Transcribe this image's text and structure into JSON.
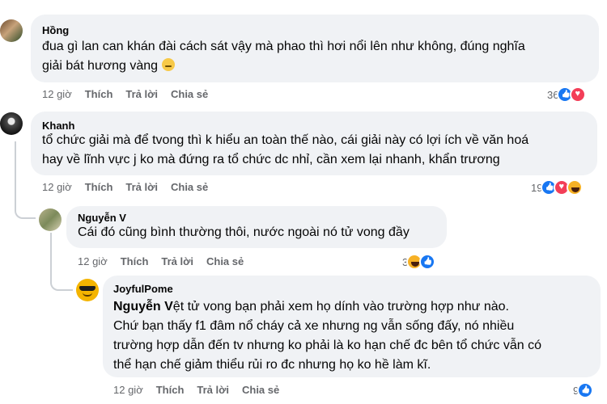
{
  "comments": [
    {
      "name": "Hồng",
      "text_line1": "đua gì lan can khán đài cách sát vậy mà phao thì hơi nổi lên như không, đúng nghĩa",
      "text_line2": "giải bát hương vàng",
      "emoji": "slightly-smiling-face",
      "time": "12 giờ",
      "like": "Thích",
      "reply": "Trả lời",
      "share": "Chia sẻ",
      "reaction_count": "36",
      "reactions": [
        "like-icon",
        "love-icon"
      ]
    },
    {
      "name": "Khanh",
      "text_line1": "tổ chức giải mà để tvong thì k hiểu an toàn thế nào, cái giải này có lợi ích về văn hoá",
      "text_line2": "hay về lĩnh vực j ko mà đứng ra tổ chức dc nhỉ, cần xem lại nhanh, khẩn trương",
      "time": "12 giờ",
      "like": "Thích",
      "reply": "Trả lời",
      "share": "Chia sẻ",
      "reaction_count": "19",
      "reactions": [
        "like-icon",
        "love-icon",
        "haha-icon"
      ]
    },
    {
      "name": "Nguyễn V",
      "text_line1": "Cái đó cũng bình thường thôi, nước ngoài nó tử vong đầy",
      "time": "12 giờ",
      "like": "Thích",
      "reply": "Trả lời",
      "share": "Chia sẻ",
      "reaction_count": "3",
      "reactions": [
        "haha-icon",
        "like-icon"
      ]
    },
    {
      "name": "JoyfulPome",
      "mention": "Nguyễn V",
      "text_line1_rest": "ệt tử vong bạn phải xem họ dính vào trường hợp như nào.",
      "text_line2": "Chứ bạn thấy f1 đâm nổ cháy cả xe nhưng ng vẫn sống đấy, nó nhiều",
      "text_line3": "trường hợp dẫn đến tv nhưng ko phải là ko hạn chế đc bên tổ chức vẫn có",
      "text_line4": "thể hạn chế giảm thiểu rủi ro đc nhưng họ ko hề làm kĩ.",
      "time": "12 giờ",
      "like": "Thích",
      "reply": "Trả lời",
      "share": "Chia sẻ",
      "reaction_count": "9",
      "reactions": [
        "like-icon"
      ]
    }
  ],
  "colors": {
    "bubble": "#f0f2f5",
    "meta_text": "#65676b",
    "like": "#1877f2",
    "love": "#f33e58",
    "haha": "#f7b125"
  }
}
